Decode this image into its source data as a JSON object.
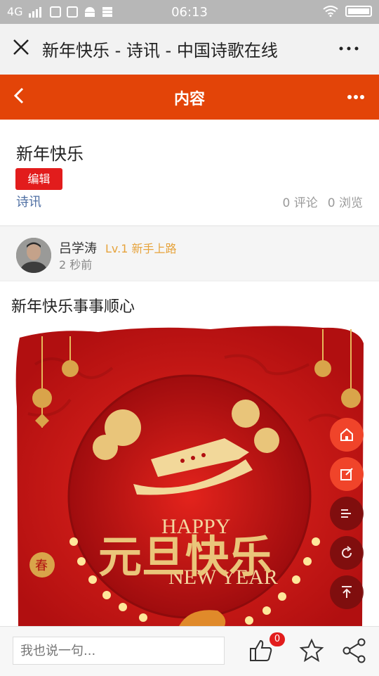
{
  "status_bar": {
    "network": "4G",
    "time": "06:13"
  },
  "title_bar": {
    "title": "新年快乐 - 诗讯 - 中国诗歌在线"
  },
  "nav": {
    "title": "内容"
  },
  "article": {
    "title": "新年快乐",
    "edit_label": "编辑",
    "category": "诗讯",
    "comments": "0 评论",
    "views": "0 浏览"
  },
  "author": {
    "name": "吕学涛",
    "level": "Lv.1 新手上路",
    "time": "2 秒前"
  },
  "content": {
    "text": "新年快乐事事顺心"
  },
  "poster": {
    "happy": "HAPPY",
    "new_year": "NEW YEAR",
    "calligraphy": "元旦快乐",
    "seal": "春"
  },
  "bottom_bar": {
    "comment_placeholder": "我也说一句...",
    "likes": "0"
  },
  "colors": {
    "accent": "#e34408",
    "tag": "#e21c1c",
    "link": "#4f6fa3",
    "level": "#e6a33c"
  }
}
